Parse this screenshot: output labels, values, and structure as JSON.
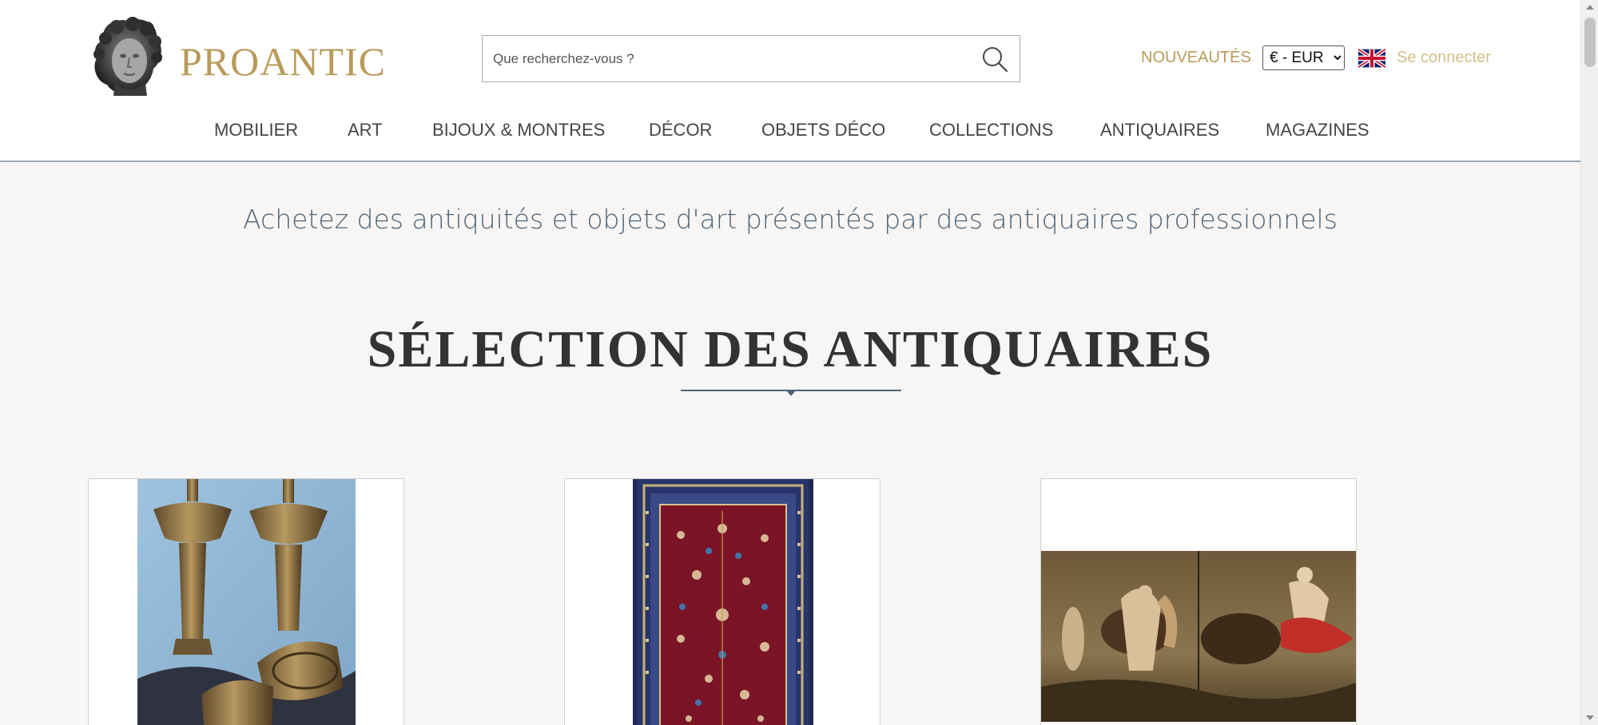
{
  "header": {
    "logo_text": "PROANTIC",
    "search": {
      "placeholder": "Que recherchez-vous ?",
      "value": ""
    },
    "new_items_label": "NOUVEAUTÉS",
    "currency": {
      "selected": "€ - EUR",
      "options": [
        "€ - EUR"
      ]
    },
    "language_icon": "uk-flag-icon",
    "login_label": "Se connecter"
  },
  "nav": {
    "items": [
      {
        "label": "MOBILIER"
      },
      {
        "label": "ART"
      },
      {
        "label": "BIJOUX & MONTRES"
      },
      {
        "label": "DÉCOR"
      },
      {
        "label": "OBJETS DÉCO"
      },
      {
        "label": "COLLECTIONS"
      },
      {
        "label": "ANTIQUAIRES"
      },
      {
        "label": "MAGAZINES"
      }
    ]
  },
  "main": {
    "tagline": "Achetez des antiquités et objets d'art présentés par des antiquaires professionnels",
    "section_title": "SÉLECTION DES ANTIQUAIRES",
    "products": [
      {
        "image": "bronze-lamps-image"
      },
      {
        "image": "persian-rug-image"
      },
      {
        "image": "old-master-painting-image"
      }
    ]
  },
  "colors": {
    "brand_gold": "#b99a59",
    "login_gold": "#d4bd8c",
    "tagline_blue": "#4f6479",
    "page_bg": "#f7f6f4"
  }
}
